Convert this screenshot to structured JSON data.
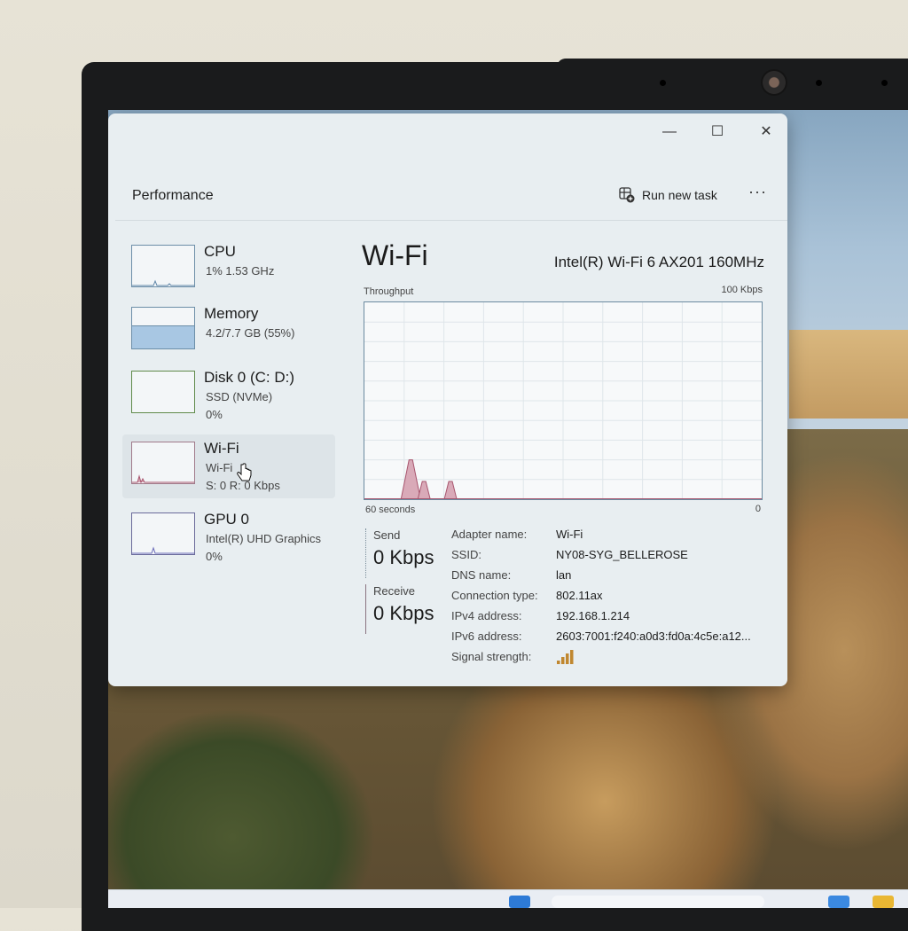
{
  "window": {
    "controls": {
      "minimize": "—",
      "maximize": "☐",
      "close": "✕"
    }
  },
  "commandbar": {
    "title": "Performance",
    "run_new_task": "Run new task",
    "more": "···"
  },
  "sidebar": {
    "items": [
      {
        "name": "CPU",
        "line1": "1%  1.53 GHz",
        "line2": ""
      },
      {
        "name": "Memory",
        "line1": "4.2/7.7 GB (55%)",
        "line2": ""
      },
      {
        "name": "Disk 0 (C: D:)",
        "line1": "SSD (NVMe)",
        "line2": "0%"
      },
      {
        "name": "Wi-Fi",
        "line1": "Wi-Fi",
        "line2": "S: 0  R: 0 Kbps"
      },
      {
        "name": "GPU 0",
        "line1": "Intel(R) UHD Graphics",
        "line2": "0%"
      }
    ],
    "selected": "Wi-Fi",
    "memory_fill_fraction": 0.55
  },
  "main": {
    "title": "Wi-Fi",
    "adapter_model": "Intel(R) Wi-Fi 6 AX201 160MHz",
    "graph_label": "Throughput",
    "graph_max": "100 Kbps",
    "graph_time": "60 seconds",
    "graph_min": "0",
    "send": {
      "label": "Send",
      "value": "0 Kbps"
    },
    "receive": {
      "label": "Receive",
      "value": "0 Kbps"
    },
    "properties": [
      {
        "key": "Adapter name:",
        "value": "Wi-Fi"
      },
      {
        "key": "SSID:",
        "value": "NY08-SYG_BELLEROSE"
      },
      {
        "key": "DNS name:",
        "value": "lan"
      },
      {
        "key": "Connection type:",
        "value": "802.11ax"
      },
      {
        "key": "IPv4 address:",
        "value": "192.168.1.214"
      },
      {
        "key": "IPv6 address:",
        "value": "2603:7001:f240:a0d3:fd0a:4c5e:a12..."
      },
      {
        "key": "Signal strength:",
        "value": ""
      }
    ],
    "signal_bars": 4
  },
  "chart_data": {
    "type": "area",
    "title": "",
    "xlabel": "60 seconds",
    "ylabel": "Throughput",
    "ylim": [
      0,
      100
    ],
    "x": [
      60,
      59,
      58,
      57,
      56,
      55,
      54,
      53,
      52,
      51,
      50,
      49,
      48,
      47,
      46,
      45,
      44,
      43,
      42,
      41,
      40,
      39,
      38,
      37,
      36,
      35,
      34,
      33,
      32,
      31,
      30,
      29,
      28,
      27,
      26,
      25,
      24,
      23,
      22,
      21,
      20,
      19,
      18,
      17,
      16,
      15,
      14,
      13,
      12,
      11,
      10,
      9,
      8,
      7,
      6,
      5,
      4,
      3,
      2,
      1,
      0
    ],
    "series": [
      {
        "values": [
          0,
          0,
          0,
          0,
          0,
          0,
          0,
          0,
          0,
          0,
          0,
          0,
          0,
          0,
          0,
          0,
          0,
          0,
          0,
          0,
          0,
          0,
          0,
          0,
          0,
          0,
          0,
          0,
          0,
          0,
          0,
          0,
          0,
          0,
          0,
          0,
          0,
          0,
          0,
          0,
          0,
          0,
          0,
          0,
          0,
          0,
          0,
          0,
          0,
          0,
          0,
          0,
          0,
          0,
          0,
          0,
          0,
          0,
          0,
          0,
          0
        ]
      }
    ],
    "peaks": [
      {
        "x": 53,
        "y": 20
      },
      {
        "x": 51,
        "y": 9
      },
      {
        "x": 47,
        "y": 9
      }
    ],
    "grid": true,
    "colors": {
      "line": "#a8556e",
      "fill": "#d9aab8",
      "grid": "#dfe6ea"
    }
  }
}
